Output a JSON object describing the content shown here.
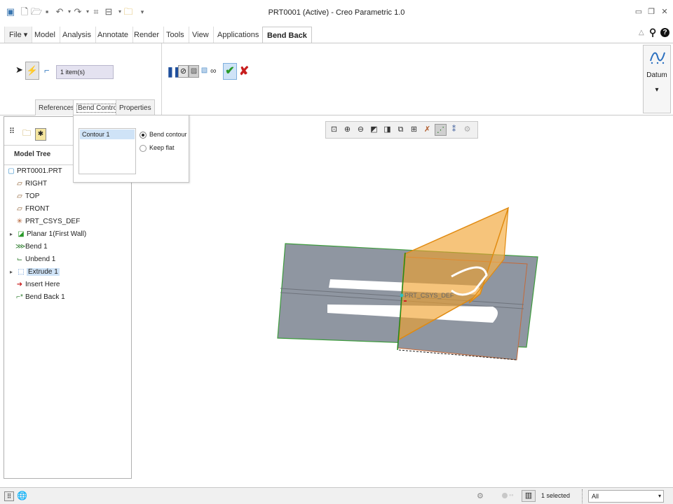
{
  "app": {
    "title": "PRT0001 (Active) - Creo Parametric 1.0"
  },
  "menu_tabs": [
    "File ▾",
    "Model",
    "Analysis",
    "Annotate",
    "Render",
    "Tools",
    "View",
    "Applications",
    "Bend Back"
  ],
  "ribbon": {
    "items_field": "1 item(s)",
    "subtabs": [
      "References",
      "Bend Control",
      "Properties"
    ],
    "datum_label": "Datum",
    "datum_arrow": "▾"
  },
  "popup": {
    "contour": "Contour 1",
    "options": [
      "Bend contour",
      "Keep flat"
    ],
    "selected_option": "Bend contour"
  },
  "model_tree": {
    "title": "Model Tree",
    "items": [
      {
        "label": "PRT0001.PRT",
        "icon": "part-icon"
      },
      {
        "label": "RIGHT",
        "icon": "datum-plane-icon"
      },
      {
        "label": "TOP",
        "icon": "datum-plane-icon"
      },
      {
        "label": "FRONT",
        "icon": "datum-plane-icon"
      },
      {
        "label": "PRT_CSYS_DEF",
        "icon": "csys-icon"
      },
      {
        "label": "Planar 1(First Wall)",
        "icon": "planar-wall-icon"
      },
      {
        "label": "Bend 1",
        "icon": "bend-icon"
      },
      {
        "label": "Unbend 1",
        "icon": "unbend-icon"
      },
      {
        "label": "Extrude 1",
        "icon": "extrude-icon"
      },
      {
        "label": "Insert Here",
        "icon": "insert-here-icon"
      },
      {
        "label": "Bend Back 1",
        "icon": "bend-back-icon"
      }
    ]
  },
  "viewport": {
    "csys_label": "PRT_CSYS_DEF"
  },
  "status": {
    "selected": "1 selected",
    "filter": "All"
  },
  "colors": {
    "accent_blue": "#1f4f9c",
    "ok_green": "#2a9a2a",
    "cancel_red": "#c81e1e",
    "sheet_gray": "#8f96a1",
    "preview_orange": "#f0a02a",
    "tree_highlight": "#cfe3f7"
  }
}
